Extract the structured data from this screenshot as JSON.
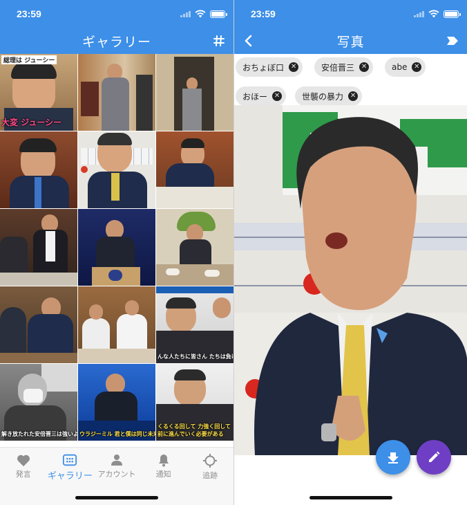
{
  "status": {
    "time": "23:59"
  },
  "gallery": {
    "title": "ギャラリー",
    "action_icon": "hash-icon",
    "tiles": [
      {
        "caption_top": "総理は ジューシー",
        "caption_bottom": "大変 ジューシー"
      },
      {
        "caption_top": "",
        "caption_bottom": ""
      },
      {
        "caption_top": "",
        "caption_bottom": ""
      },
      {
        "caption_top": "",
        "caption_bottom": ""
      },
      {
        "caption_top": "",
        "caption_bottom": ""
      },
      {
        "caption_top": "",
        "caption_bottom": ""
      },
      {
        "caption_top": "",
        "caption_bottom": ""
      },
      {
        "caption_top": "",
        "caption_bottom": ""
      },
      {
        "caption_top": "",
        "caption_bottom": ""
      },
      {
        "caption_top": "",
        "caption_bottom": ""
      },
      {
        "caption_top": "",
        "caption_bottom": ""
      },
      {
        "caption_top": "",
        "caption_bottom": "んな人たちに皆さん たちは負けるわけにはいかない"
      },
      {
        "caption_top": "",
        "caption_bottom": "解き放たれた安倍晋三は強いよ"
      },
      {
        "caption_top": "",
        "caption_bottom": "ウラジーミル 君と僕は同じ未来を見ている"
      },
      {
        "caption_top": "",
        "caption_bottom": "くるくる回して 力強く回して 前に進んでいく必要がある"
      }
    ]
  },
  "bottom_nav": [
    {
      "label": "発言",
      "icon": "heart-icon",
      "active": false
    },
    {
      "label": "ギャラリー",
      "icon": "gallery-icon",
      "active": true
    },
    {
      "label": "アカウント",
      "icon": "person-icon",
      "active": false
    },
    {
      "label": "通知",
      "icon": "bell-icon",
      "active": false
    },
    {
      "label": "追跡",
      "icon": "crosshair-icon",
      "active": false
    }
  ],
  "photo_view": {
    "title": "写真",
    "back_icon": "chevron-left-icon",
    "tag_action_icon": "tag-icon",
    "tags": [
      "おちょぼ口",
      "安倍晋三",
      "abe",
      "おほー",
      "世襲の暴力"
    ],
    "fab_download_icon": "download-icon",
    "fab_edit_icon": "pencil-icon"
  },
  "colors": {
    "primary": "#3d8fe8",
    "accent_purple": "#6e3fc4",
    "chip_bg": "#e6e6e6",
    "nav_inactive": "#8e8e8e"
  }
}
